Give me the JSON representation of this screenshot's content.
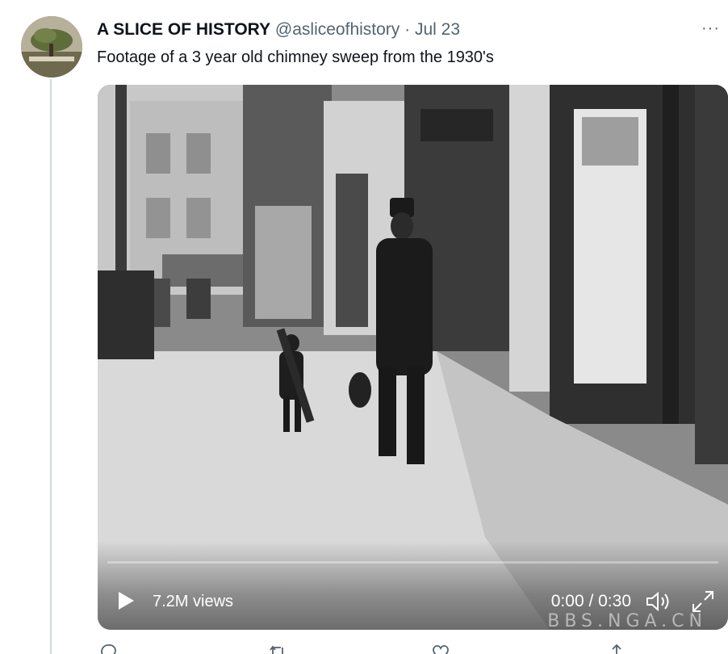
{
  "tweet": {
    "author_name": "A SLICE OF HISTORY",
    "handle": "@asliceofhistory",
    "separator": "·",
    "date": "Jul 23",
    "text": "Footage of a 3 year old chimney sweep from the 1930's",
    "more_label": "···"
  },
  "video": {
    "views": "7.2M views",
    "time": "0:00 / 0:30",
    "progress_fraction": 0,
    "watermark": "BBS.NGA.CN"
  },
  "icons": {
    "play": "play-icon",
    "volume": "volume-icon",
    "fullscreen": "fullscreen-icon",
    "reply": "reply-icon",
    "retweet": "retweet-icon",
    "like": "heart-icon",
    "share": "share-icon"
  },
  "colors": {
    "text_primary": "#0f1419",
    "text_secondary": "#536471",
    "thread_line": "#cfd9de"
  }
}
